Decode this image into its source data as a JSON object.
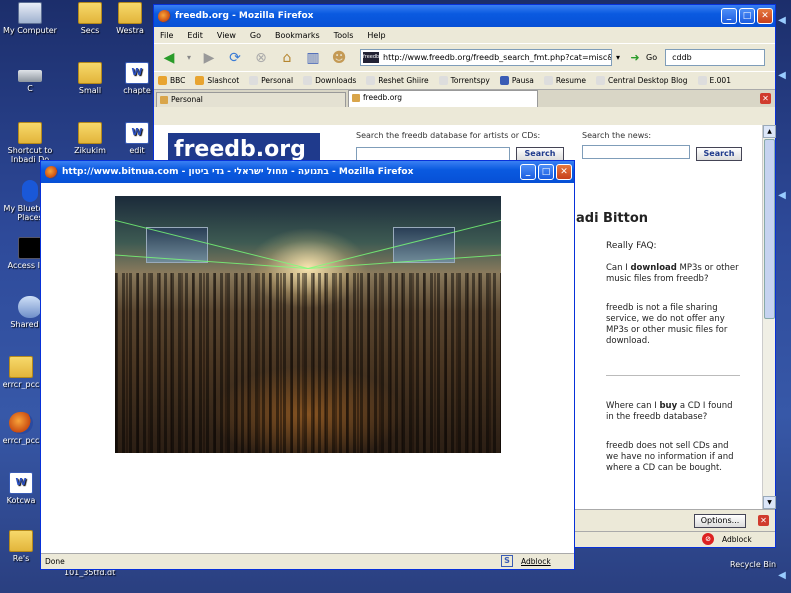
{
  "desktop": {
    "icons": [
      {
        "label": "My Computer",
        "icon": "computer-icon"
      },
      {
        "label": "Secs",
        "icon": "folder-icon"
      },
      {
        "label": "Westra",
        "icon": "folder-icon"
      },
      {
        "label": "C",
        "icon": "drive-icon"
      },
      {
        "label": "Small",
        "icon": "folder-icon"
      },
      {
        "label": "chapte",
        "icon": "word-doc-icon"
      },
      {
        "label": "Shortcut to Inbadi Do",
        "icon": "folder-icon"
      },
      {
        "label": "Zikukim",
        "icon": "folder-icon"
      },
      {
        "label": "edit",
        "icon": "word-doc-icon"
      },
      {
        "label": "My Bluetooth Places",
        "icon": "bluetooth-icon"
      },
      {
        "label": "Access IBM",
        "icon": "ibm-icon"
      },
      {
        "label": "Shared To",
        "icon": "network-icon"
      },
      {
        "label": "errcr_pcc",
        "icon": "folder-icon"
      },
      {
        "label": "errcr_pcc",
        "icon": "firefox-icon"
      },
      {
        "label": "Kotcwa",
        "icon": "word-doc-icon"
      },
      {
        "label": "Re's",
        "icon": "folder-icon"
      }
    ],
    "bottom_labels": {
      "left": "101_35tfd.dt",
      "right": "Recycle Bin"
    }
  },
  "main_window": {
    "title": "freedb.org - Mozilla Firefox",
    "menu": [
      "File",
      "Edit",
      "View",
      "Go",
      "Bookmarks",
      "Tools",
      "Help"
    ],
    "url": "http://www.freedb.org/freedb_search_fmt.php?cat=misc&id=",
    "go_label": "Go",
    "search_value": "cddb",
    "bookmarks": [
      "BBC",
      "Slashcot",
      "Personal",
      "Downloads",
      "Reshet Ghiire",
      "Torrentspy",
      "Pausa",
      "Resume",
      "Central Desktop Blog",
      "E.001"
    ],
    "tabs": [
      {
        "label": "Personal",
        "active": false
      },
      {
        "label": "freedb.org",
        "active": true
      }
    ],
    "page": {
      "logo": "freedb.org",
      "search_db_label": "Search the freedb database for artists or CDs:",
      "search_news_label": "Search the news:",
      "search_button": "Search",
      "artist_heading": "adi Bitton",
      "faq_title": "Really FAQ:",
      "faq": [
        {
          "q_pre": "Can I ",
          "q_bold": "download",
          "q_post": " MP3s or other music files from freedb?",
          "a": "freedb is not a file sharing service, we do not offer any MP3s or other music files for download."
        },
        {
          "q_pre": "Where can I ",
          "q_bold": "buy",
          "q_post": " a CD I found in the freedb database?",
          "a": "freedb does not sell CDs and we have no information if and where a CD can be bought."
        }
      ]
    },
    "options_button": "Options...",
    "status_adblock": "Adblock"
  },
  "popup_window": {
    "title": "http://www.bitnua.com - בתנועה - מחול ישראלי - גדי ביטון - Mozilla Firefox",
    "status_text": "Done",
    "status_adblock": "Adblock"
  },
  "colors": {
    "xp_title_blue": "#0a5ae0",
    "freedb_blue": "#1f3a8c",
    "close_red": "#c7401c"
  }
}
